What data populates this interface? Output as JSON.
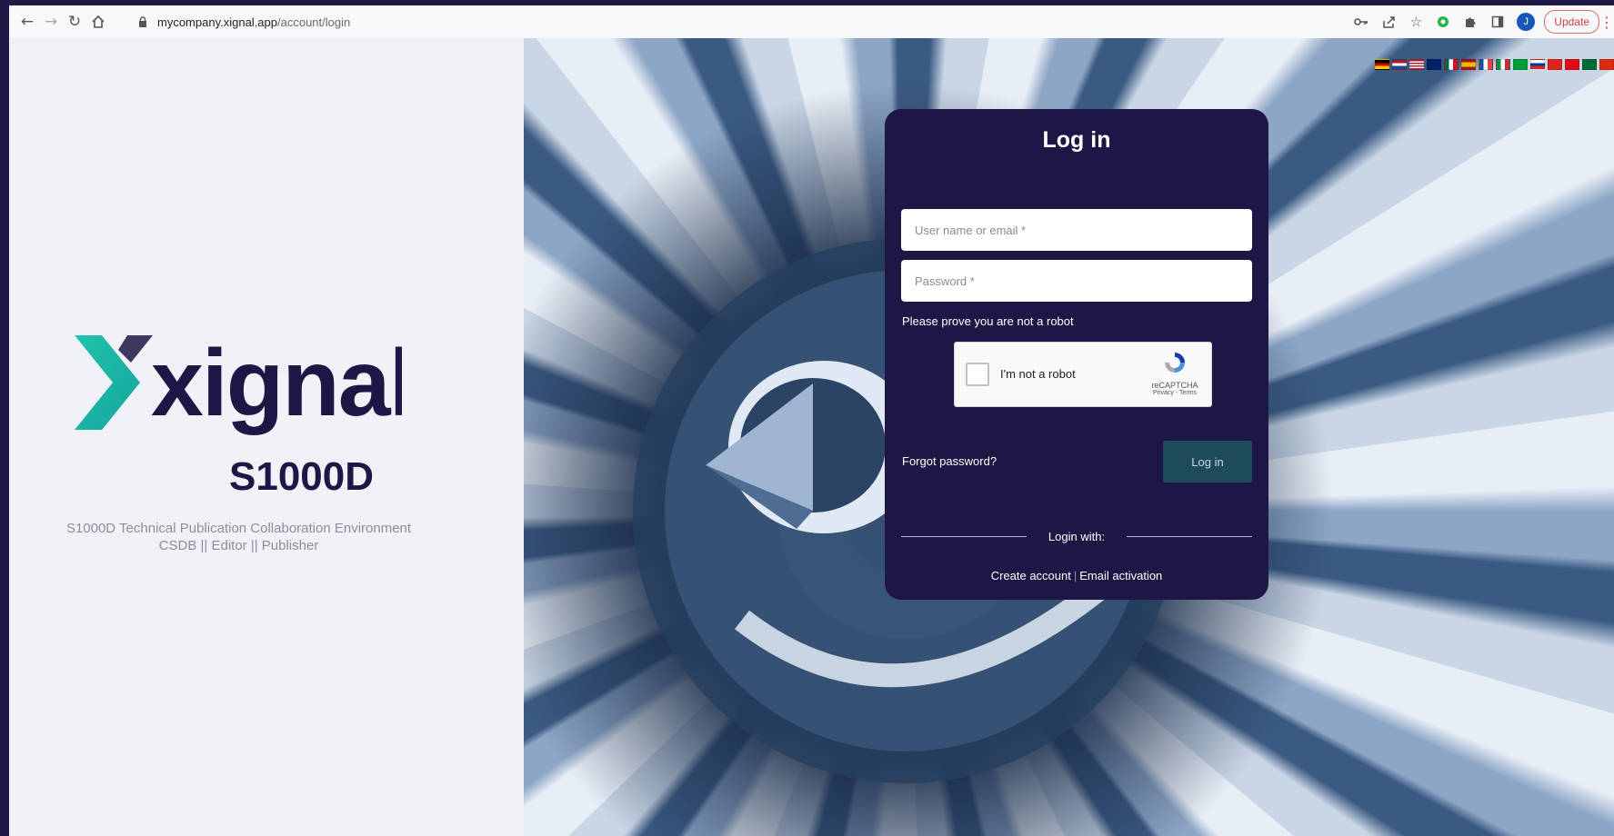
{
  "browser": {
    "url_host": "mycompany.xignal.app",
    "url_path": "/account/login",
    "avatar_letter": "J",
    "update_label": "Update",
    "icons": {
      "back": "back-arrow-icon",
      "forward": "forward-arrow-icon",
      "reload": "reload-icon",
      "home": "home-icon",
      "lock": "lock-icon",
      "key": "key-icon",
      "share": "share-icon",
      "star": "star-icon",
      "extension_green": "extension-icon",
      "puzzle": "puzzle-icon",
      "sidepanel": "side-panel-icon",
      "menu": "kebab-menu-icon"
    }
  },
  "brand": {
    "logo_text": "xignal",
    "logo_sub": "S1000D",
    "tagline_line1": "S1000D Technical Publication Collaboration Environment",
    "tagline_line2": "CSDB || Editor || Publisher",
    "colors": {
      "logo_dark": "#1e1645",
      "logo_accent": "#1fc4a8"
    }
  },
  "languages": [
    "de",
    "nl",
    "us",
    "gb",
    "mx",
    "es",
    "fr",
    "it",
    "br",
    "ru",
    "vn",
    "tr",
    "sa",
    "cn"
  ],
  "login": {
    "title": "Log in",
    "username_placeholder": "User name or email *",
    "password_placeholder": "Password *",
    "robot_note": "Please prove you are not a robot",
    "recaptcha_label": "I'm not a robot",
    "recaptcha_brand": "reCAPTCHA",
    "recaptcha_terms": "Privacy - Terms",
    "forgot_label": "Forgot password?",
    "submit_label": "Log in",
    "login_with": "Login with:",
    "create_account": "Create account",
    "separator": "|",
    "email_activation": "Email activation",
    "colors": {
      "card": "#1e1645",
      "button": "#1d4b5a"
    }
  }
}
